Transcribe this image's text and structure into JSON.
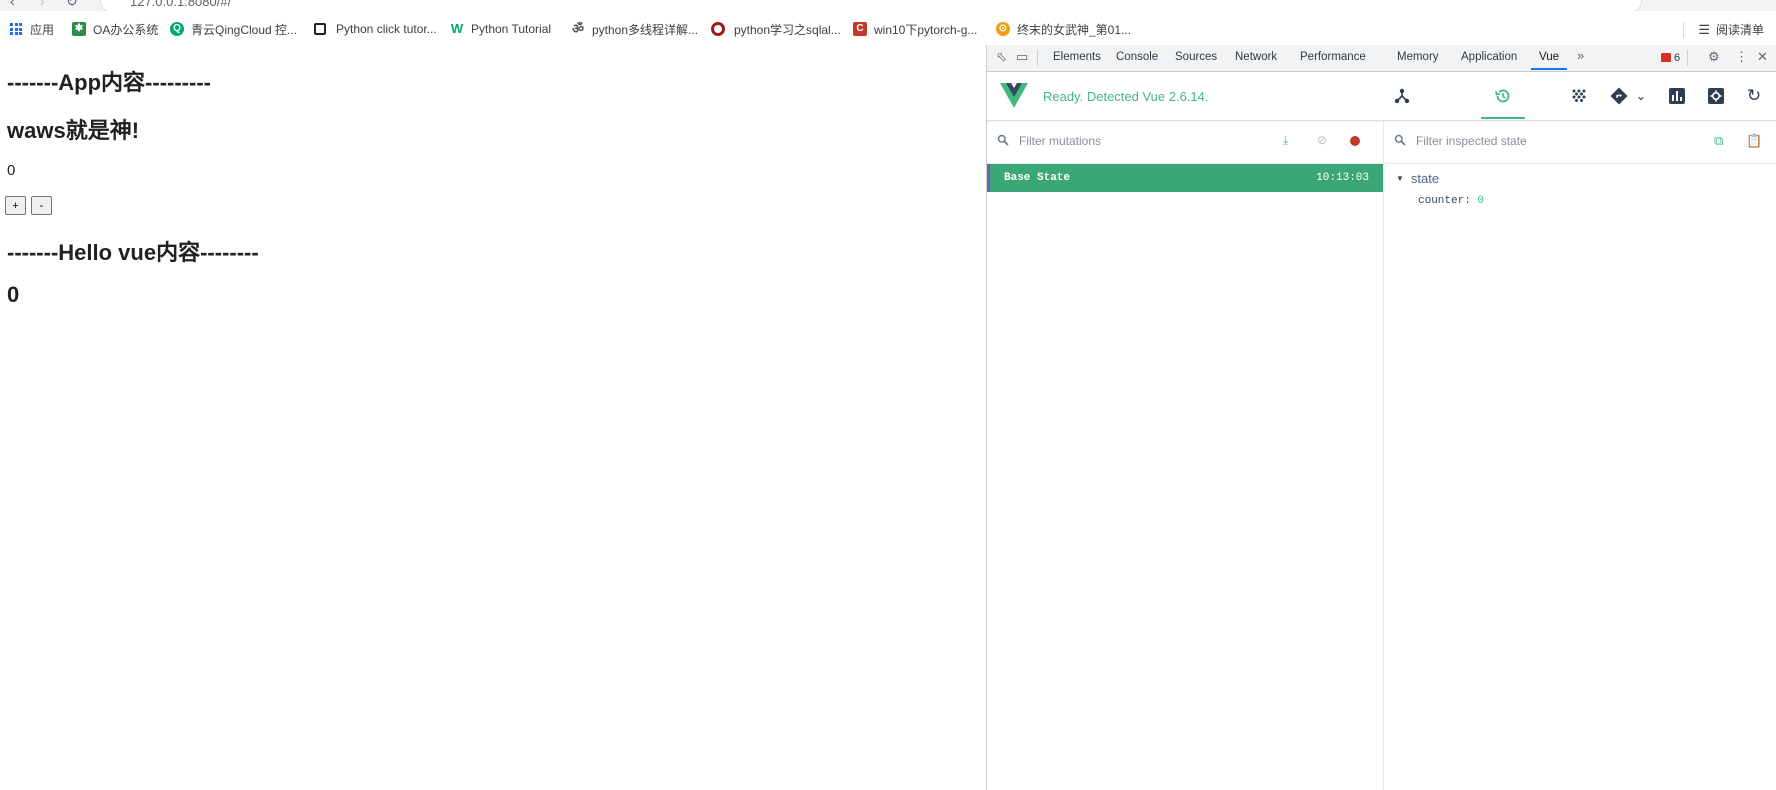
{
  "browser": {
    "address": "127.0.0.1:8080/#/",
    "bookmarks": [
      {
        "label": "应用",
        "icon": "apps-grid-icon"
      },
      {
        "label": "OA办公系统",
        "icon": "oa-icon",
        "color": "#2d8a4e"
      },
      {
        "label": "青云QingCloud 控...",
        "icon": "qingcloud-icon",
        "color": "#00a971"
      },
      {
        "label": "Python click tutor...",
        "icon": "page-icon",
        "color": "#222222"
      },
      {
        "label": "Python Tutorial",
        "icon": "w3-icon",
        "color": "#04aa6d"
      },
      {
        "label": "python多线程详解...",
        "icon": "omega-icon",
        "color": "#555555"
      },
      {
        "label": "python学习之sqlal...",
        "icon": "target-icon",
        "color": "#9b1c1c"
      },
      {
        "label": "win10下pytorch-g...",
        "icon": "csdn-icon",
        "color": "#c0392b"
      },
      {
        "label": "终末的女武神_第01...",
        "icon": "orange-circle-icon",
        "color": "#f39c12"
      }
    ],
    "reading_list": "阅读清单"
  },
  "page": {
    "app_heading": "-------App内容---------",
    "waws_heading": "waws就是神!",
    "counter_value": "0",
    "plus_label": "+",
    "minus_label": "-",
    "hello_heading": "-------Hello vue内容--------",
    "hello_counter": "0"
  },
  "devtools": {
    "tabs": [
      "Elements",
      "Console",
      "Sources",
      "Network",
      "Performance",
      "Memory",
      "Application",
      "Vue"
    ],
    "active_tab": "Vue",
    "error_count": "6",
    "vue": {
      "status": "Ready. Detected Vue 2.6.14.",
      "accent": "#42b983",
      "mutations_filter_placeholder": "Filter mutations",
      "state_filter_placeholder": "Filter inspected state",
      "mutation": {
        "name": "Base State",
        "time": "10:13:03"
      },
      "state_title": "state",
      "state_prop": "counter",
      "state_value": "0"
    }
  }
}
